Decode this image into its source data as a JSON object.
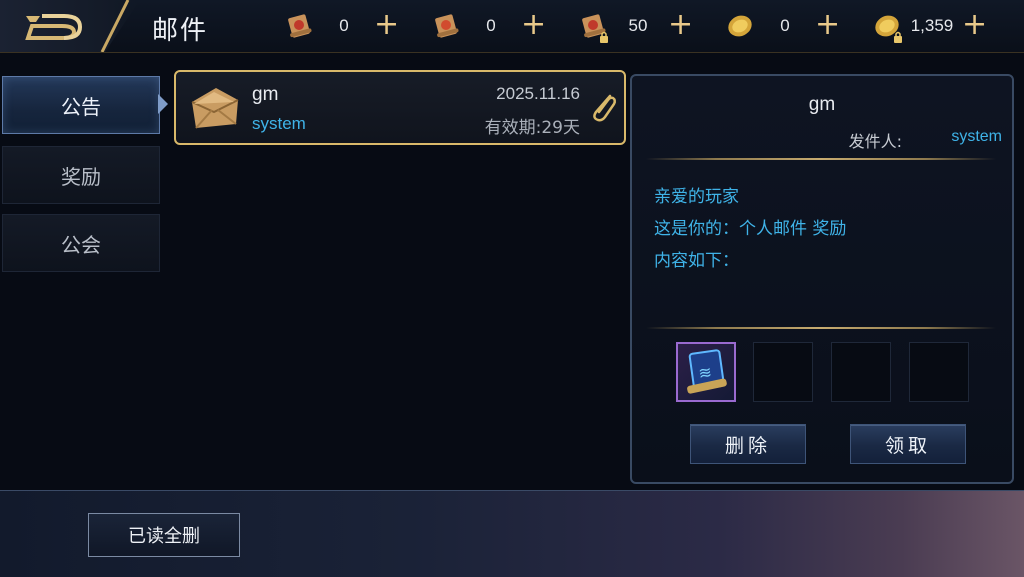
{
  "header": {
    "title": "邮件",
    "back_icon": "back-arrow-icon"
  },
  "currencies": [
    {
      "icon": "red-scroll-icon",
      "value": "0",
      "locked": false
    },
    {
      "icon": "red-scroll-icon",
      "value": "0",
      "locked": false
    },
    {
      "icon": "red-scroll-icon",
      "value": "50",
      "locked": true
    },
    {
      "icon": "gold-coin-icon",
      "value": "0",
      "locked": false
    },
    {
      "icon": "gold-coin-icon",
      "value": "1,359",
      "locked": true
    }
  ],
  "plus_label": "+",
  "tabs": [
    {
      "label": "公告",
      "active": true
    },
    {
      "label": "奖励",
      "active": false
    },
    {
      "label": "公会",
      "active": false
    }
  ],
  "mail_list": [
    {
      "sender": "gm",
      "from": "system",
      "date": "2025.11.16",
      "expiry": "有效期:29天",
      "has_attachment": true,
      "icon": "envelope-icon"
    }
  ],
  "detail": {
    "sender": "gm",
    "from_label": "发件人:",
    "from_value": "system",
    "body": [
      "亲爱的玩家",
      "这是你的：个人邮件 奖励",
      "内容如下："
    ],
    "attachments": [
      {
        "icon": "skill-book-icon",
        "filled": true
      },
      {
        "filled": false
      },
      {
        "filled": false
      },
      {
        "filled": false
      }
    ],
    "delete_label": "删除",
    "claim_label": "领取"
  },
  "footer": {
    "read_delete_label": "已读全删"
  },
  "colors": {
    "accent_gold": "#d9b96a",
    "link_blue": "#3fb3e8",
    "panel_border": "#394a63"
  }
}
